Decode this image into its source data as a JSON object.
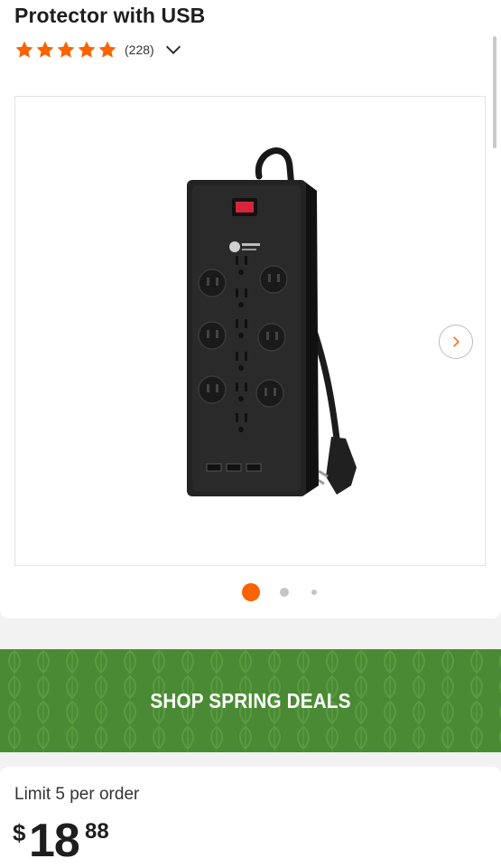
{
  "product": {
    "title": "Protector with USB",
    "rating_value": 5,
    "review_count": "(228)"
  },
  "gallery": {
    "image_alt": "Black 12-outlet surge protector power strip with 3 USB ports",
    "dots": 3,
    "active_dot": 0
  },
  "banner": {
    "label": "SHOP SPRING DEALS"
  },
  "purchase": {
    "limit_text": "Limit 5 per order",
    "price_currency": "$",
    "price_dollars": "18",
    "price_cents": "88"
  },
  "colors": {
    "accent": "#f96302",
    "banner_green": "#4a8a34"
  }
}
